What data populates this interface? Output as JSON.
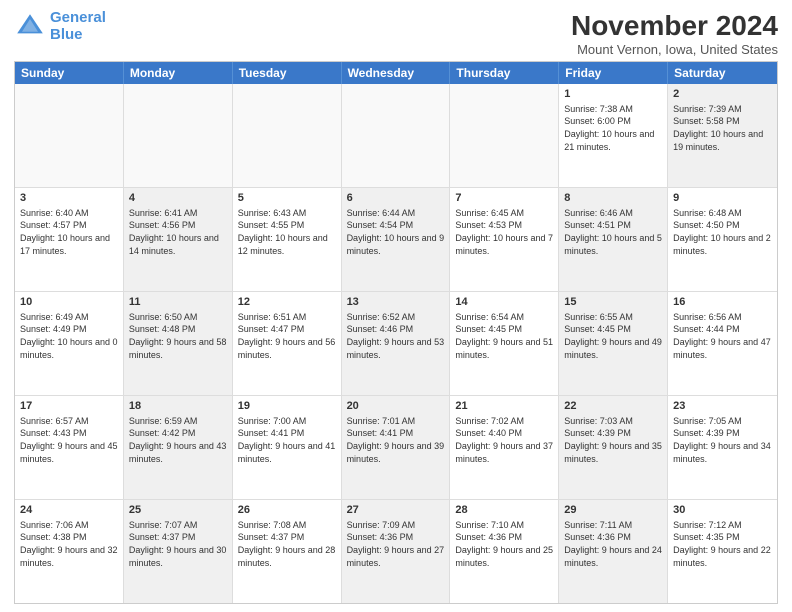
{
  "header": {
    "logo_line1": "General",
    "logo_line2": "Blue",
    "month": "November 2024",
    "location": "Mount Vernon, Iowa, United States"
  },
  "weekdays": [
    "Sunday",
    "Monday",
    "Tuesday",
    "Wednesday",
    "Thursday",
    "Friday",
    "Saturday"
  ],
  "rows": [
    [
      {
        "day": "",
        "info": "",
        "shaded": false,
        "empty": true
      },
      {
        "day": "",
        "info": "",
        "shaded": false,
        "empty": true
      },
      {
        "day": "",
        "info": "",
        "shaded": false,
        "empty": true
      },
      {
        "day": "",
        "info": "",
        "shaded": false,
        "empty": true
      },
      {
        "day": "",
        "info": "",
        "shaded": false,
        "empty": true
      },
      {
        "day": "1",
        "info": "Sunrise: 7:38 AM\nSunset: 6:00 PM\nDaylight: 10 hours and 21 minutes.",
        "shaded": false,
        "empty": false
      },
      {
        "day": "2",
        "info": "Sunrise: 7:39 AM\nSunset: 5:58 PM\nDaylight: 10 hours and 19 minutes.",
        "shaded": true,
        "empty": false
      }
    ],
    [
      {
        "day": "3",
        "info": "Sunrise: 6:40 AM\nSunset: 4:57 PM\nDaylight: 10 hours and 17 minutes.",
        "shaded": false,
        "empty": false
      },
      {
        "day": "4",
        "info": "Sunrise: 6:41 AM\nSunset: 4:56 PM\nDaylight: 10 hours and 14 minutes.",
        "shaded": true,
        "empty": false
      },
      {
        "day": "5",
        "info": "Sunrise: 6:43 AM\nSunset: 4:55 PM\nDaylight: 10 hours and 12 minutes.",
        "shaded": false,
        "empty": false
      },
      {
        "day": "6",
        "info": "Sunrise: 6:44 AM\nSunset: 4:54 PM\nDaylight: 10 hours and 9 minutes.",
        "shaded": true,
        "empty": false
      },
      {
        "day": "7",
        "info": "Sunrise: 6:45 AM\nSunset: 4:53 PM\nDaylight: 10 hours and 7 minutes.",
        "shaded": false,
        "empty": false
      },
      {
        "day": "8",
        "info": "Sunrise: 6:46 AM\nSunset: 4:51 PM\nDaylight: 10 hours and 5 minutes.",
        "shaded": true,
        "empty": false
      },
      {
        "day": "9",
        "info": "Sunrise: 6:48 AM\nSunset: 4:50 PM\nDaylight: 10 hours and 2 minutes.",
        "shaded": false,
        "empty": false
      }
    ],
    [
      {
        "day": "10",
        "info": "Sunrise: 6:49 AM\nSunset: 4:49 PM\nDaylight: 10 hours and 0 minutes.",
        "shaded": false,
        "empty": false
      },
      {
        "day": "11",
        "info": "Sunrise: 6:50 AM\nSunset: 4:48 PM\nDaylight: 9 hours and 58 minutes.",
        "shaded": true,
        "empty": false
      },
      {
        "day": "12",
        "info": "Sunrise: 6:51 AM\nSunset: 4:47 PM\nDaylight: 9 hours and 56 minutes.",
        "shaded": false,
        "empty": false
      },
      {
        "day": "13",
        "info": "Sunrise: 6:52 AM\nSunset: 4:46 PM\nDaylight: 9 hours and 53 minutes.",
        "shaded": true,
        "empty": false
      },
      {
        "day": "14",
        "info": "Sunrise: 6:54 AM\nSunset: 4:45 PM\nDaylight: 9 hours and 51 minutes.",
        "shaded": false,
        "empty": false
      },
      {
        "day": "15",
        "info": "Sunrise: 6:55 AM\nSunset: 4:45 PM\nDaylight: 9 hours and 49 minutes.",
        "shaded": true,
        "empty": false
      },
      {
        "day": "16",
        "info": "Sunrise: 6:56 AM\nSunset: 4:44 PM\nDaylight: 9 hours and 47 minutes.",
        "shaded": false,
        "empty": false
      }
    ],
    [
      {
        "day": "17",
        "info": "Sunrise: 6:57 AM\nSunset: 4:43 PM\nDaylight: 9 hours and 45 minutes.",
        "shaded": false,
        "empty": false
      },
      {
        "day": "18",
        "info": "Sunrise: 6:59 AM\nSunset: 4:42 PM\nDaylight: 9 hours and 43 minutes.",
        "shaded": true,
        "empty": false
      },
      {
        "day": "19",
        "info": "Sunrise: 7:00 AM\nSunset: 4:41 PM\nDaylight: 9 hours and 41 minutes.",
        "shaded": false,
        "empty": false
      },
      {
        "day": "20",
        "info": "Sunrise: 7:01 AM\nSunset: 4:41 PM\nDaylight: 9 hours and 39 minutes.",
        "shaded": true,
        "empty": false
      },
      {
        "day": "21",
        "info": "Sunrise: 7:02 AM\nSunset: 4:40 PM\nDaylight: 9 hours and 37 minutes.",
        "shaded": false,
        "empty": false
      },
      {
        "day": "22",
        "info": "Sunrise: 7:03 AM\nSunset: 4:39 PM\nDaylight: 9 hours and 35 minutes.",
        "shaded": true,
        "empty": false
      },
      {
        "day": "23",
        "info": "Sunrise: 7:05 AM\nSunset: 4:39 PM\nDaylight: 9 hours and 34 minutes.",
        "shaded": false,
        "empty": false
      }
    ],
    [
      {
        "day": "24",
        "info": "Sunrise: 7:06 AM\nSunset: 4:38 PM\nDaylight: 9 hours and 32 minutes.",
        "shaded": false,
        "empty": false
      },
      {
        "day": "25",
        "info": "Sunrise: 7:07 AM\nSunset: 4:37 PM\nDaylight: 9 hours and 30 minutes.",
        "shaded": true,
        "empty": false
      },
      {
        "day": "26",
        "info": "Sunrise: 7:08 AM\nSunset: 4:37 PM\nDaylight: 9 hours and 28 minutes.",
        "shaded": false,
        "empty": false
      },
      {
        "day": "27",
        "info": "Sunrise: 7:09 AM\nSunset: 4:36 PM\nDaylight: 9 hours and 27 minutes.",
        "shaded": true,
        "empty": false
      },
      {
        "day": "28",
        "info": "Sunrise: 7:10 AM\nSunset: 4:36 PM\nDaylight: 9 hours and 25 minutes.",
        "shaded": false,
        "empty": false
      },
      {
        "day": "29",
        "info": "Sunrise: 7:11 AM\nSunset: 4:36 PM\nDaylight: 9 hours and 24 minutes.",
        "shaded": true,
        "empty": false
      },
      {
        "day": "30",
        "info": "Sunrise: 7:12 AM\nSunset: 4:35 PM\nDaylight: 9 hours and 22 minutes.",
        "shaded": false,
        "empty": false
      }
    ]
  ]
}
